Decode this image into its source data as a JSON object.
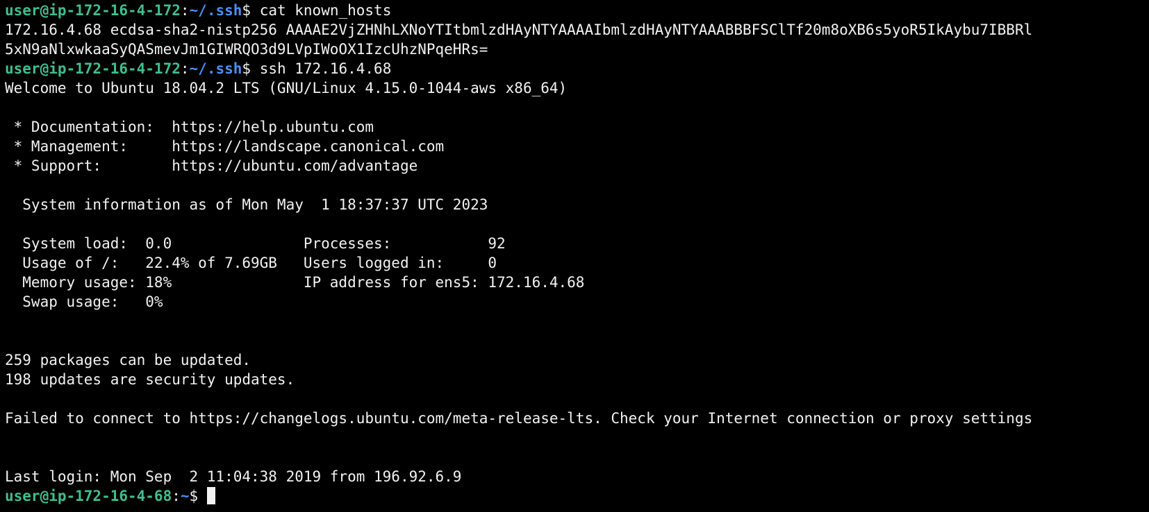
{
  "colors": {
    "background": "#000000",
    "text": "#f2f2f2",
    "prompt_user": "#3fbf8f",
    "prompt_path": "#4b8ff7"
  },
  "session": {
    "prompt1": {
      "user_host": "user@ip-172-16-4-172",
      "path": "~/.ssh",
      "command": "cat known_hosts"
    },
    "known_hosts_line1": "172.16.4.68 ecdsa-sha2-nistp256 AAAAE2VjZHNhLXNoYTItbmlzdHAyNTYAAAAIbmlzdHAyNTYAAABBBFSClTf20m8oXB6s5yoR5IkAybu7IBBRl",
    "known_hosts_line2": "5xN9aNlxwkaaSyQASmevJm1GIWRQO3d9LVpIWoOX1IzcUhzNPqeHRs=",
    "prompt2": {
      "user_host": "user@ip-172-16-4-172",
      "path": "~/.ssh",
      "command": "ssh 172.16.4.68"
    },
    "welcome": "Welcome to Ubuntu 18.04.2 LTS (GNU/Linux 4.15.0-1044-aws x86_64)",
    "doc_line": " * Documentation:  https://help.ubuntu.com",
    "mgmt_line": " * Management:     https://landscape.canonical.com",
    "support_line": " * Support:        https://ubuntu.com/advantage",
    "sysinfo_header": "  System information as of Mon May  1 18:37:37 UTC 2023",
    "sysinfo_rows": [
      "  System load:  0.0               Processes:           92",
      "  Usage of /:   22.4% of 7.69GB   Users logged in:     0",
      "  Memory usage: 18%               IP address for ens5: 172.16.4.68",
      "  Swap usage:   0%"
    ],
    "packages_line": "259 packages can be updated.",
    "security_line": "198 updates are security updates.",
    "failed_line": "Failed to connect to https://changelogs.ubuntu.com/meta-release-lts. Check your Internet connection or proxy settings",
    "last_login": "Last login: Mon Sep  2 11:04:38 2019 from 196.92.6.9",
    "prompt3": {
      "user_host": "user@ip-172-16-4-68",
      "path": "~"
    }
  }
}
